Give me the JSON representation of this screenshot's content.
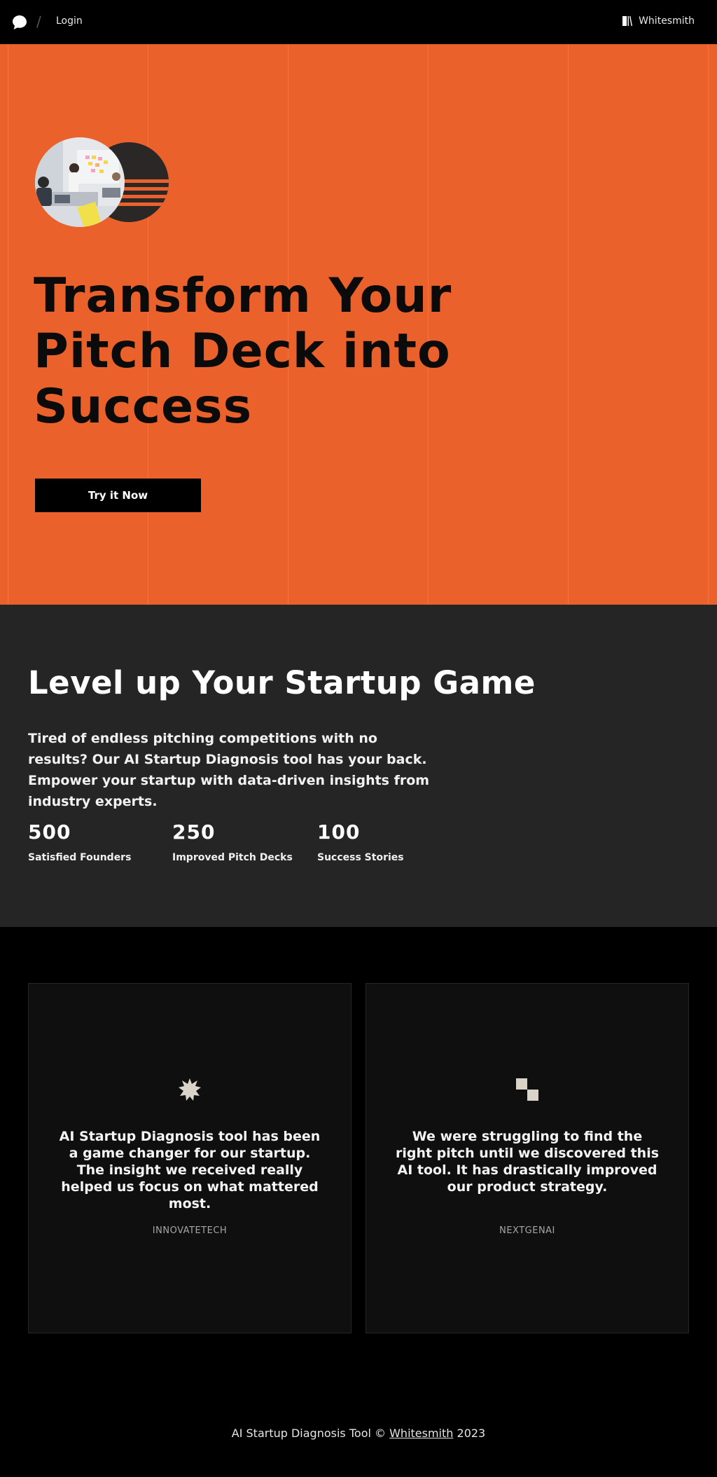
{
  "nav": {
    "logo_icon": "chat-bubble-icon",
    "separator": "/",
    "login_label": "Login",
    "brand_label": "Whitesmith",
    "brand_icon": "whitesmith-mark-icon"
  },
  "hero": {
    "background_color": "#eb612b",
    "title_line1": "Transform Your",
    "title_line2": "Pitch Deck into",
    "title_line3": "Success",
    "cta_label": "Try it Now"
  },
  "stats": {
    "title": "Level up Your Startup Game",
    "description": "Tired of endless pitching competitions with no results? Our AI Startup Diagnosis tool has your back. Empower your startup with data-driven insights from industry experts.",
    "items": [
      {
        "value": "500",
        "label": "Satisfied Founders"
      },
      {
        "value": "250",
        "label": "Improved Pitch Decks"
      },
      {
        "value": "100",
        "label": "Success Stories"
      }
    ]
  },
  "testimonials": [
    {
      "icon": "starburst-icon",
      "quote": "AI Startup Diagnosis tool has been a game changer for our startup. The insight we received really helped us focus on what mattered most.",
      "author": "INNOVATETECH"
    },
    {
      "icon": "stacked-squares-icon",
      "quote": "We were struggling to find the right pitch until we discovered this AI tool. It has drastically improved our product strategy.",
      "author": "NEXTGENAI"
    }
  ],
  "footer": {
    "prefix": "AI Startup Diagnosis Tool ©",
    "link_label": "Whitesmith",
    "year": "2023"
  },
  "colors": {
    "accent": "#eb612b",
    "dark_section": "#262525",
    "card": "#0f0f0f"
  }
}
